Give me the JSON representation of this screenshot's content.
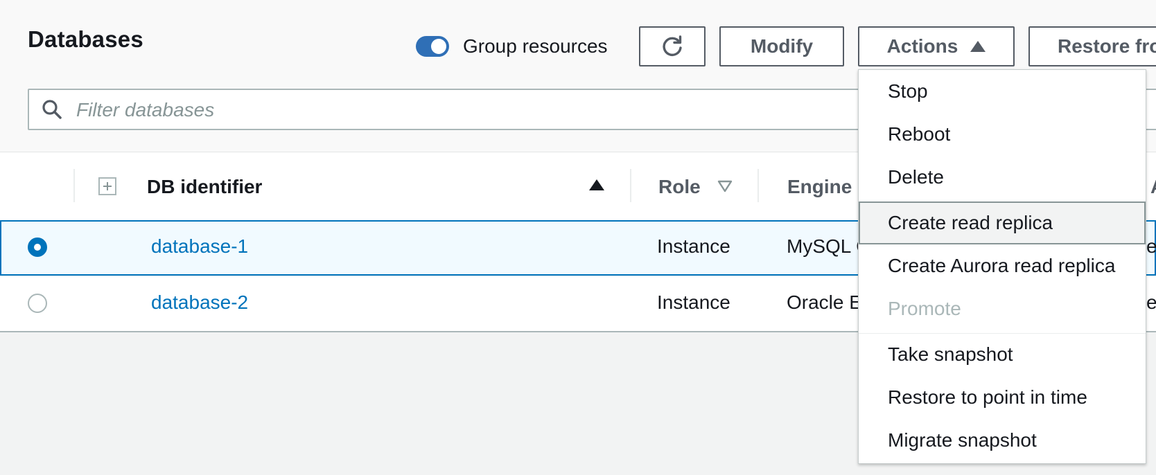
{
  "header": {
    "title": "Databases",
    "group_toggle": {
      "label": "Group resources",
      "on": true
    },
    "buttons": {
      "refresh_icon": "refresh-icon",
      "modify": "Modify",
      "actions": "Actions",
      "restore": "Restore fro"
    },
    "search": {
      "placeholder": "Filter databases",
      "value": ""
    }
  },
  "table": {
    "columns": {
      "db_identifier": "DB identifier",
      "role": "Role",
      "engine": "Engine",
      "next_partial": "A"
    },
    "rows": [
      {
        "identifier": "database-1",
        "role": "Instance",
        "engine": "MySQL C",
        "trailing": "ea",
        "selected": true
      },
      {
        "identifier": "database-2",
        "role": "Instance",
        "engine": "Oracle E",
        "trailing": "ea",
        "selected": false
      }
    ]
  },
  "actions_menu": {
    "items": [
      {
        "label": "Stop",
        "state": "normal"
      },
      {
        "label": "Reboot",
        "state": "normal"
      },
      {
        "label": "Delete",
        "state": "normal"
      },
      {
        "label": "Create read replica",
        "state": "hover"
      },
      {
        "label": "Create Aurora read replica",
        "state": "normal"
      },
      {
        "label": "Promote",
        "state": "disabled"
      },
      {
        "label": "Take snapshot",
        "state": "normal"
      },
      {
        "label": "Restore to point in time",
        "state": "normal"
      },
      {
        "label": "Migrate snapshot",
        "state": "normal"
      }
    ]
  },
  "colors": {
    "accent": "#0073bb",
    "toggle_on": "#2f6fb6",
    "selected_row_bg": "#f1faff",
    "disabled_text": "#aab7b8"
  }
}
